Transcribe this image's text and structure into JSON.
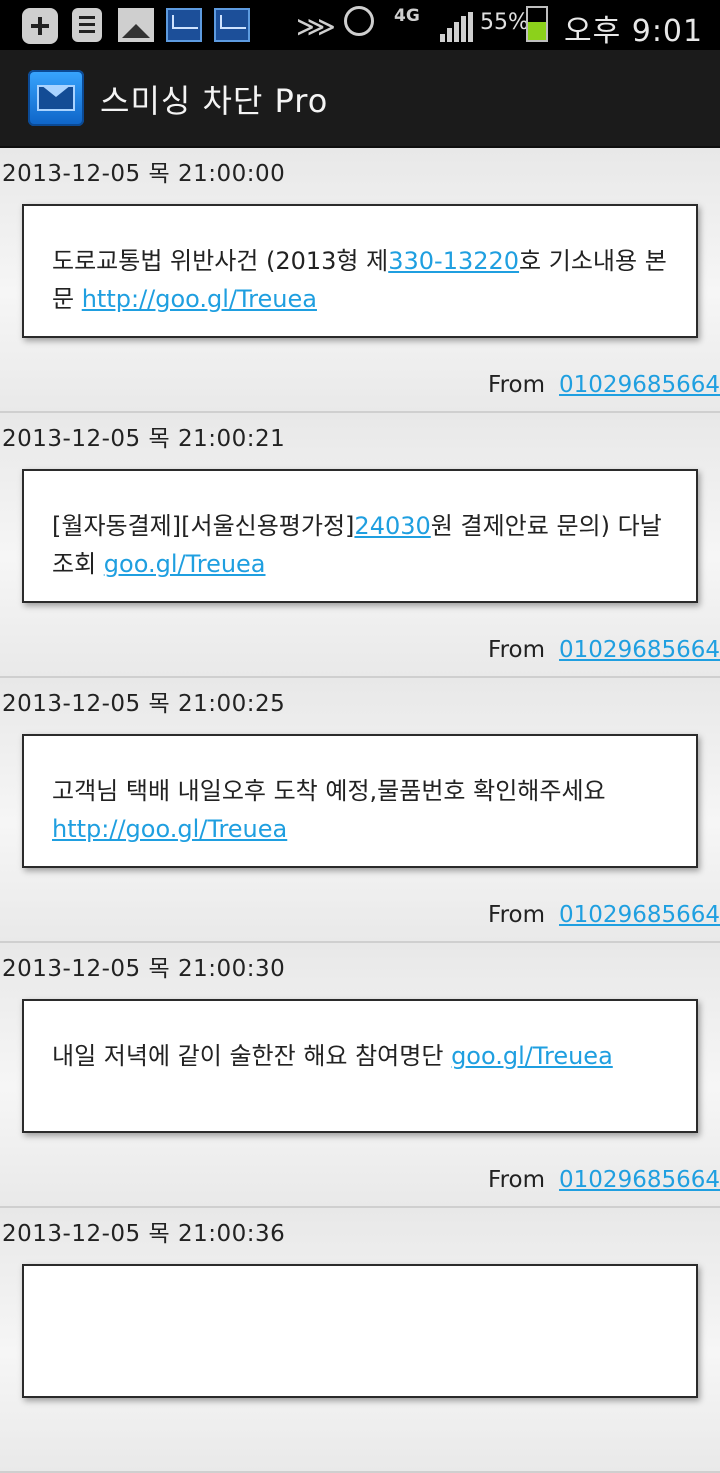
{
  "status_bar": {
    "network": "4G",
    "battery_pct": "55%",
    "battery_level": 0.55,
    "time": "오후 9:01",
    "icons": [
      "add-icon",
      "list-icon",
      "image-icon",
      "mail-icon",
      "mail-icon",
      "mute-icon",
      "alarm-icon",
      "signal-icon",
      "battery-icon"
    ]
  },
  "app": {
    "title": "스미싱 차단 Pro",
    "icon": "envelope-icon"
  },
  "messages": [
    {
      "date": "2013-12-05 목 21:00:00",
      "text_a": "도로교통법 위반사건 (2013형 제",
      "link_a": "330-13220",
      "text_b": "호 기소내용 본문 ",
      "link_b": "http://goo.gl/Treuea",
      "from_label": "From",
      "from_number": "01029685664"
    },
    {
      "date": "2013-12-05 목 21:00:21",
      "text_a": "[월자동결제][서울신용평가정]",
      "link_a": "24030",
      "text_b": "원 결제안료 문의) 다날 조회 ",
      "link_b": "goo.gl/Treuea",
      "from_label": "From",
      "from_number": "01029685664"
    },
    {
      "date": "2013-12-05 목 21:00:25",
      "text_a": "고객님 택배 내일오후 도착 예정,물품번호 확인해주세요 ",
      "link_a": "",
      "text_b": "",
      "link_b": "http://goo.gl/Treuea",
      "from_label": "From",
      "from_number": "01029685664"
    },
    {
      "date": "2013-12-05 목 21:00:30",
      "text_a": "내일 저녁에 같이 술한잔 해요 참여명단 ",
      "link_a": "",
      "text_b": "",
      "link_b": "goo.gl/Treuea",
      "from_label": "From",
      "from_number": "01029685664"
    },
    {
      "date": "2013-12-05 목 21:00:36",
      "text_a": "",
      "link_a": "",
      "text_b": "",
      "link_b": "",
      "from_label": "",
      "from_number": ""
    }
  ]
}
